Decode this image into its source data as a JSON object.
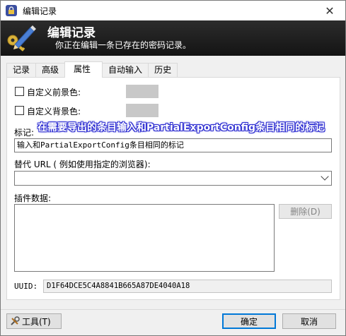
{
  "window": {
    "title": "编辑记录",
    "close_glyph": "✕"
  },
  "banner": {
    "title": "编辑记录",
    "subtitle": "你正在编辑一条已存在的密码记录。",
    "icon": "pencil-key-icon"
  },
  "tabs": [
    {
      "label": "记录",
      "active": false
    },
    {
      "label": "高级",
      "active": false
    },
    {
      "label": "属性",
      "active": true
    },
    {
      "label": "自动输入",
      "active": false
    },
    {
      "label": "历史",
      "active": false
    }
  ],
  "properties": {
    "custom_foreground_label": "自定义前景色:",
    "custom_background_label": "自定义背景色:",
    "swatch_color": "#c8c8c8",
    "tags_label": "标记:",
    "tags_value": "输入和PartialExportConfig条目相同的标记",
    "tooltip_text": "在需要导出的条目输入和PartialExportConfig条目相同的标记",
    "override_url_label": "替代 URL ( 例如使用指定的浏览器):",
    "override_url_value": "",
    "plugin_data_label": "插件数据:",
    "delete_button": "删除(D)",
    "uuid_label": "UUID:",
    "uuid_value": "D1F64DCE5C4A8841B665A87DE4040A18"
  },
  "footer": {
    "tools_button": "工具(T)",
    "ok_button": "确定",
    "cancel_button": "取消"
  },
  "colors": {
    "accent": "#0078d7",
    "tooltip_outline": "#2b2bd1",
    "banner_bg": "#1c1c1c"
  }
}
